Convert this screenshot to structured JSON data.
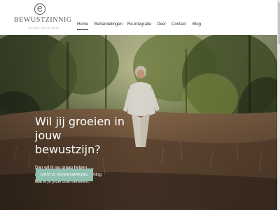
{
  "brand": {
    "name": "BEWUSTZINNIG",
    "tagline": "worden wie je bent"
  },
  "nav": {
    "items": [
      {
        "label": "Home",
        "active": true
      },
      {
        "label": "Behandelingen",
        "active": false
      },
      {
        "label": "Re-integratie",
        "active": false
      },
      {
        "label": "Over",
        "active": false
      },
      {
        "label": "Contact",
        "active": false
      },
      {
        "label": "Blog",
        "active": false
      }
    ]
  },
  "hero": {
    "headline_lines": [
      "Wil jij groeien in",
      "jouw",
      "bewustzijn?"
    ],
    "sub_lines": [
      "Dan wil ik jou graag helpen......",
      "met relevante therapie of coaching",
      "laat ik je jouw doel bereiken."
    ],
    "cta_label": "GRATIS KENNISMAKING"
  },
  "colors": {
    "accent": "#8fbfae",
    "text_dark": "#333333",
    "brand_gold": "#b9a58a"
  },
  "icons": {
    "logo": "circle-e-logo-icon"
  }
}
